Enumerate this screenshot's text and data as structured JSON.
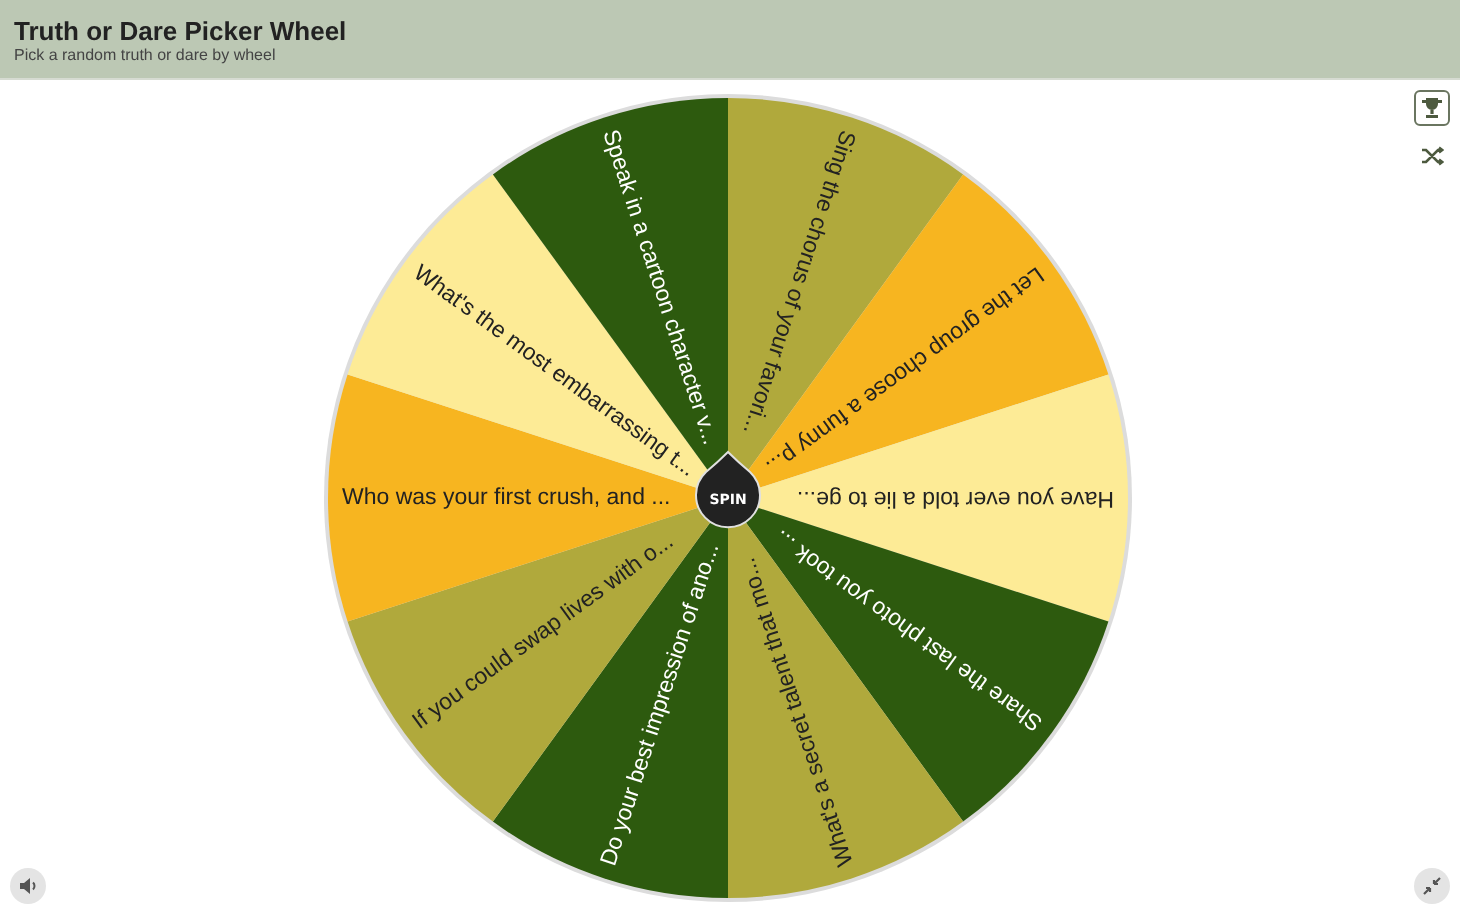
{
  "header": {
    "title": "Truth or Dare Picker Wheel",
    "subtitle": "Pick a random truth or dare by wheel"
  },
  "wheel": {
    "segments": [
      {
        "text": "Sing the chorus of your favori...",
        "color": "#b0a93c"
      },
      {
        "text": "Let the group choose a funny p...",
        "color": "#f7b520"
      },
      {
        "text": "Have you ever told a lie to ge...",
        "color": "#fdeb96"
      },
      {
        "text": "Share the last photo you took ...",
        "color": "#2d5a0e"
      },
      {
        "text": "What's a secret talent that mo...",
        "color": "#b0a93c"
      },
      {
        "text": "Do your best impression of ano...",
        "color": "#2d5a0e"
      },
      {
        "text": "If you could swap lives with o...",
        "color": "#b0a93c"
      },
      {
        "text": "Who was your first crush, and ...",
        "color": "#f7b520"
      },
      {
        "text": "What's the most embarrassing t...",
        "color": "#fdeb96"
      },
      {
        "text": "Speak in a cartoon character v...",
        "color": "#2d5a0e"
      }
    ],
    "spin_button": "SPIN"
  }
}
